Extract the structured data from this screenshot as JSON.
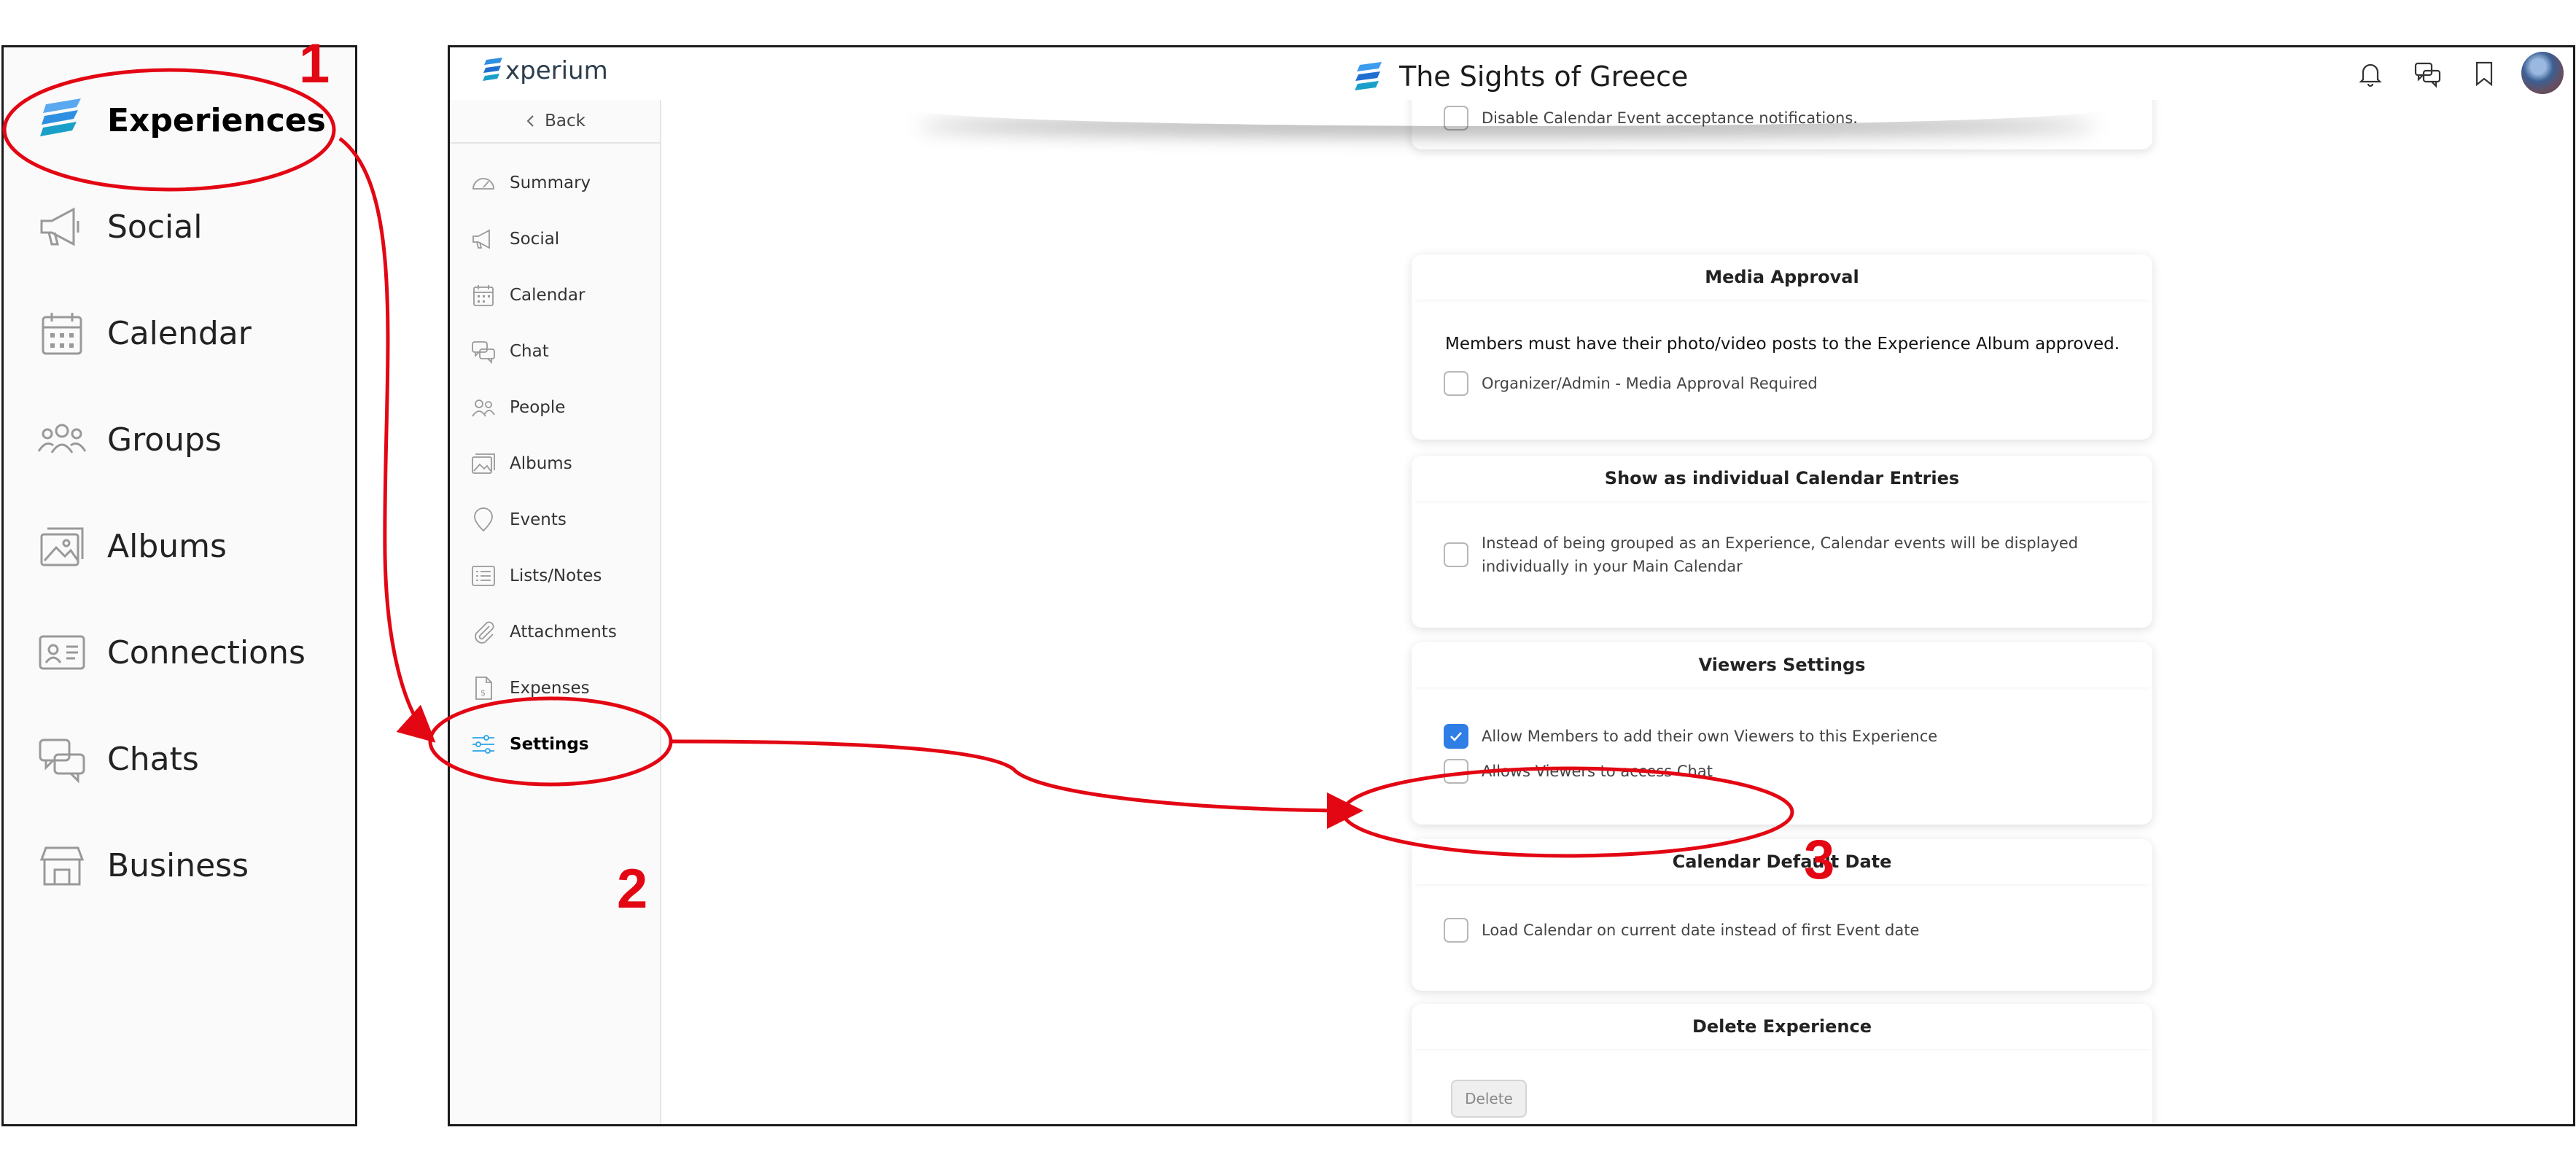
{
  "zoom_panel": {
    "items": [
      {
        "label": "Experiences",
        "icon": "experium-logo-icon",
        "active": true
      },
      {
        "label": "Social",
        "icon": "megaphone-icon"
      },
      {
        "label": "Calendar",
        "icon": "calendar-icon"
      },
      {
        "label": "Groups",
        "icon": "groups-icon"
      },
      {
        "label": "Albums",
        "icon": "albums-icon"
      },
      {
        "label": "Connections",
        "icon": "contact-card-icon"
      },
      {
        "label": "Chats",
        "icon": "chat-bubbles-icon"
      },
      {
        "label": "Business",
        "icon": "storefront-icon"
      }
    ]
  },
  "app": {
    "logo_text": "xperium",
    "title": "The Sights of Greece",
    "header_icons": [
      "bell-icon",
      "chat-icon",
      "bookmark-icon",
      "avatar"
    ],
    "back_label": "Back",
    "sidebar": [
      {
        "label": "Summary",
        "icon": "gauge-icon"
      },
      {
        "label": "Social",
        "icon": "megaphone-icon"
      },
      {
        "label": "Calendar",
        "icon": "calendar-icon"
      },
      {
        "label": "Chat",
        "icon": "chat-icon"
      },
      {
        "label": "People",
        "icon": "people-icon"
      },
      {
        "label": "Albums",
        "icon": "albums-icon"
      },
      {
        "label": "Events",
        "icon": "map-pin-icon"
      },
      {
        "label": "Lists/Notes",
        "icon": "list-icon"
      },
      {
        "label": "Attachments",
        "icon": "paperclip-icon"
      },
      {
        "label": "Expenses",
        "icon": "receipt-icon"
      },
      {
        "label": "Settings",
        "icon": "sliders-icon",
        "active": true
      }
    ],
    "cards": {
      "notifications": {
        "option": "Disable Calendar Event acceptance notifications.",
        "checked": false
      },
      "media_approval": {
        "title": "Media Approval",
        "description": "Members must have their photo/video posts to the Experience Album approved.",
        "option": "Organizer/Admin - Media Approval Required",
        "checked": false
      },
      "individual_entries": {
        "title": "Show as individual Calendar Entries",
        "option_line1": "Instead of being grouped as an Experience, Calendar events will be displayed",
        "option_line2": "individually in your Main Calendar",
        "checked": false
      },
      "viewers": {
        "title": "Viewers Settings",
        "option1": "Allow Members to add their own Viewers to this Experience",
        "option1_checked": true,
        "option2": "Allows Viewers to access Chat",
        "option2_checked": false
      },
      "default_date": {
        "title": "Calendar Default Date",
        "option": "Load Calendar on current date instead of first Event date",
        "checked": false
      },
      "delete": {
        "title": "Delete Experience",
        "button": "Delete"
      }
    }
  },
  "annotations": {
    "step1": "1",
    "step2": "2",
    "step3": "3",
    "color": "#e30613"
  }
}
